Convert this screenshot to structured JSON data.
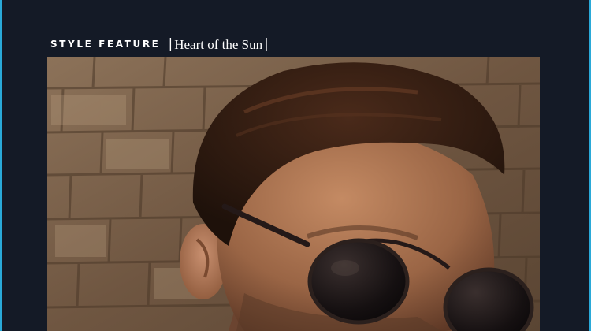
{
  "header": {
    "section_label": "STYLE FEATURE",
    "title": "Heart of the Sun"
  },
  "photo": {
    "subject": "man wearing round dark sunglasses in front of brick wall",
    "tone": "#8a6a4c"
  }
}
